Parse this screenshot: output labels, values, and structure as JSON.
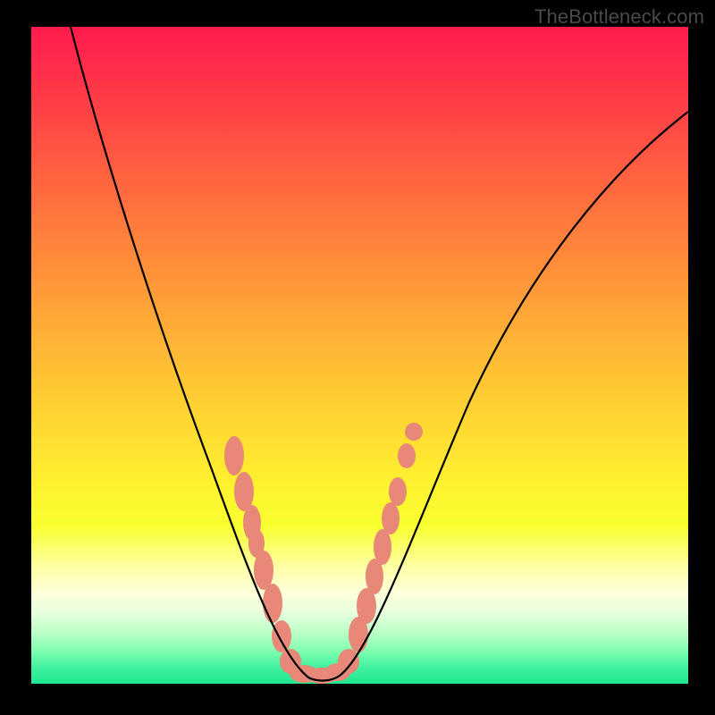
{
  "watermark": "TheBottleneck.com",
  "chart_data": {
    "type": "line",
    "title": "",
    "xlabel": "",
    "ylabel": "",
    "xlim": [
      0,
      100
    ],
    "ylim": [
      0,
      100
    ],
    "background": "gradient-rainbow-vertical",
    "series": [
      {
        "name": "bottleneck-curve",
        "x": [
          6,
          10,
          15,
          20,
          25,
          30,
          33,
          35,
          37,
          38,
          39,
          40,
          41,
          42,
          43,
          44,
          46,
          50,
          55,
          60,
          65,
          70,
          75,
          80,
          85,
          90,
          95,
          100
        ],
        "y": [
          100,
          88,
          73,
          59,
          46,
          33,
          26,
          20,
          14,
          10,
          6,
          3,
          1,
          0,
          0,
          1,
          4,
          12,
          22,
          31,
          39,
          47,
          54,
          60,
          66,
          71,
          76,
          80
        ],
        "color": "#000000"
      }
    ],
    "markers": [
      {
        "name": "cluster-left",
        "x_range": [
          30,
          42
        ],
        "y_range": [
          0,
          38
        ],
        "color": "#e88878"
      },
      {
        "name": "cluster-right",
        "x_range": [
          44,
          56
        ],
        "y_range": [
          0,
          42
        ],
        "color": "#e88878"
      }
    ]
  }
}
